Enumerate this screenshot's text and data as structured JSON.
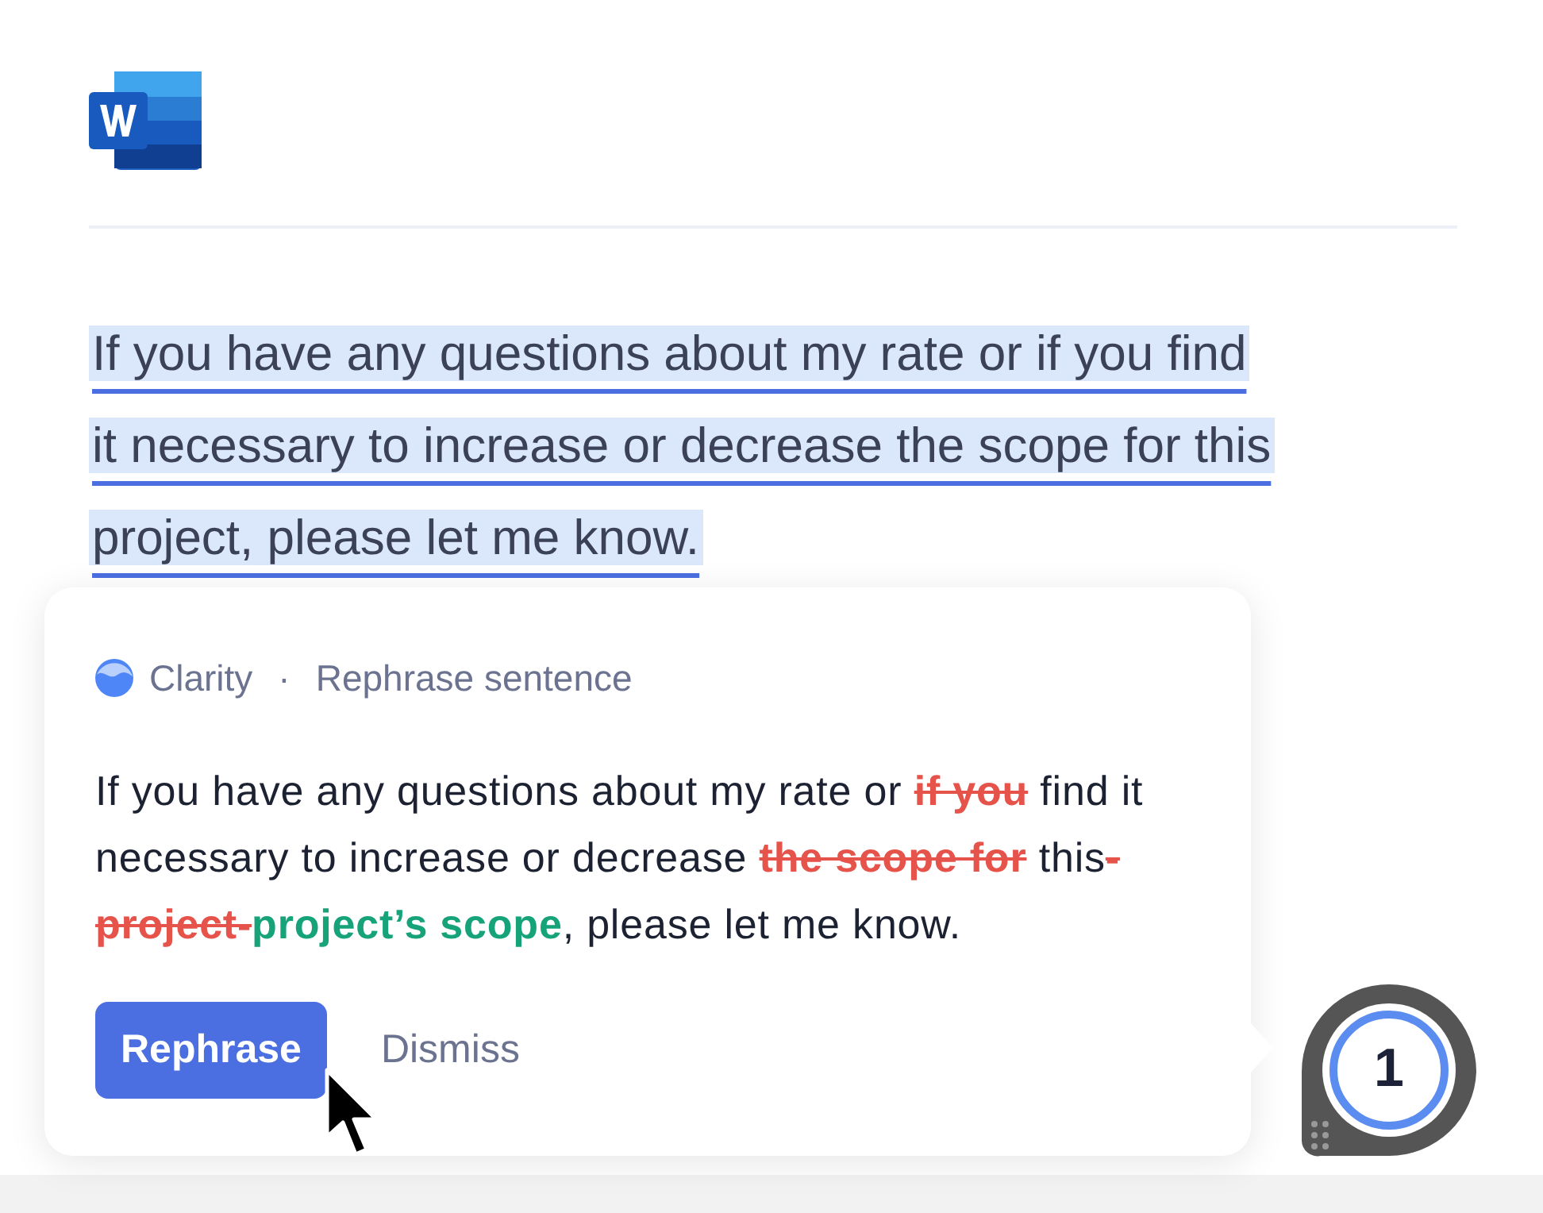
{
  "document": {
    "lines": [
      "If you have any questions about my rate or if you find",
      "it necessary to increase or decrease the scope for this",
      "project, please let me know."
    ],
    "highlighted": true
  },
  "suggestion_card": {
    "category": "Clarity",
    "separator": "·",
    "title": "Rephrase sentence",
    "segments": [
      {
        "kind": "plain",
        "text": "If you have any questions about my rate or "
      },
      {
        "kind": "deleted",
        "text": "if you"
      },
      {
        "kind": "plain",
        "text": " find it necessary to increase or decrease "
      },
      {
        "kind": "deleted",
        "text": "the scope for"
      },
      {
        "kind": "plain",
        "text": " this"
      },
      {
        "kind": "deleted",
        "text": "-project-"
      },
      {
        "kind": "inserted",
        "text": "project’s scope"
      },
      {
        "kind": "plain",
        "text": ", please let me know."
      }
    ],
    "buttons": [
      {
        "label": "Rephrase",
        "kind": "primary"
      },
      {
        "label": "Dismiss",
        "kind": "link"
      }
    ]
  },
  "badge": {
    "count": "1"
  }
}
